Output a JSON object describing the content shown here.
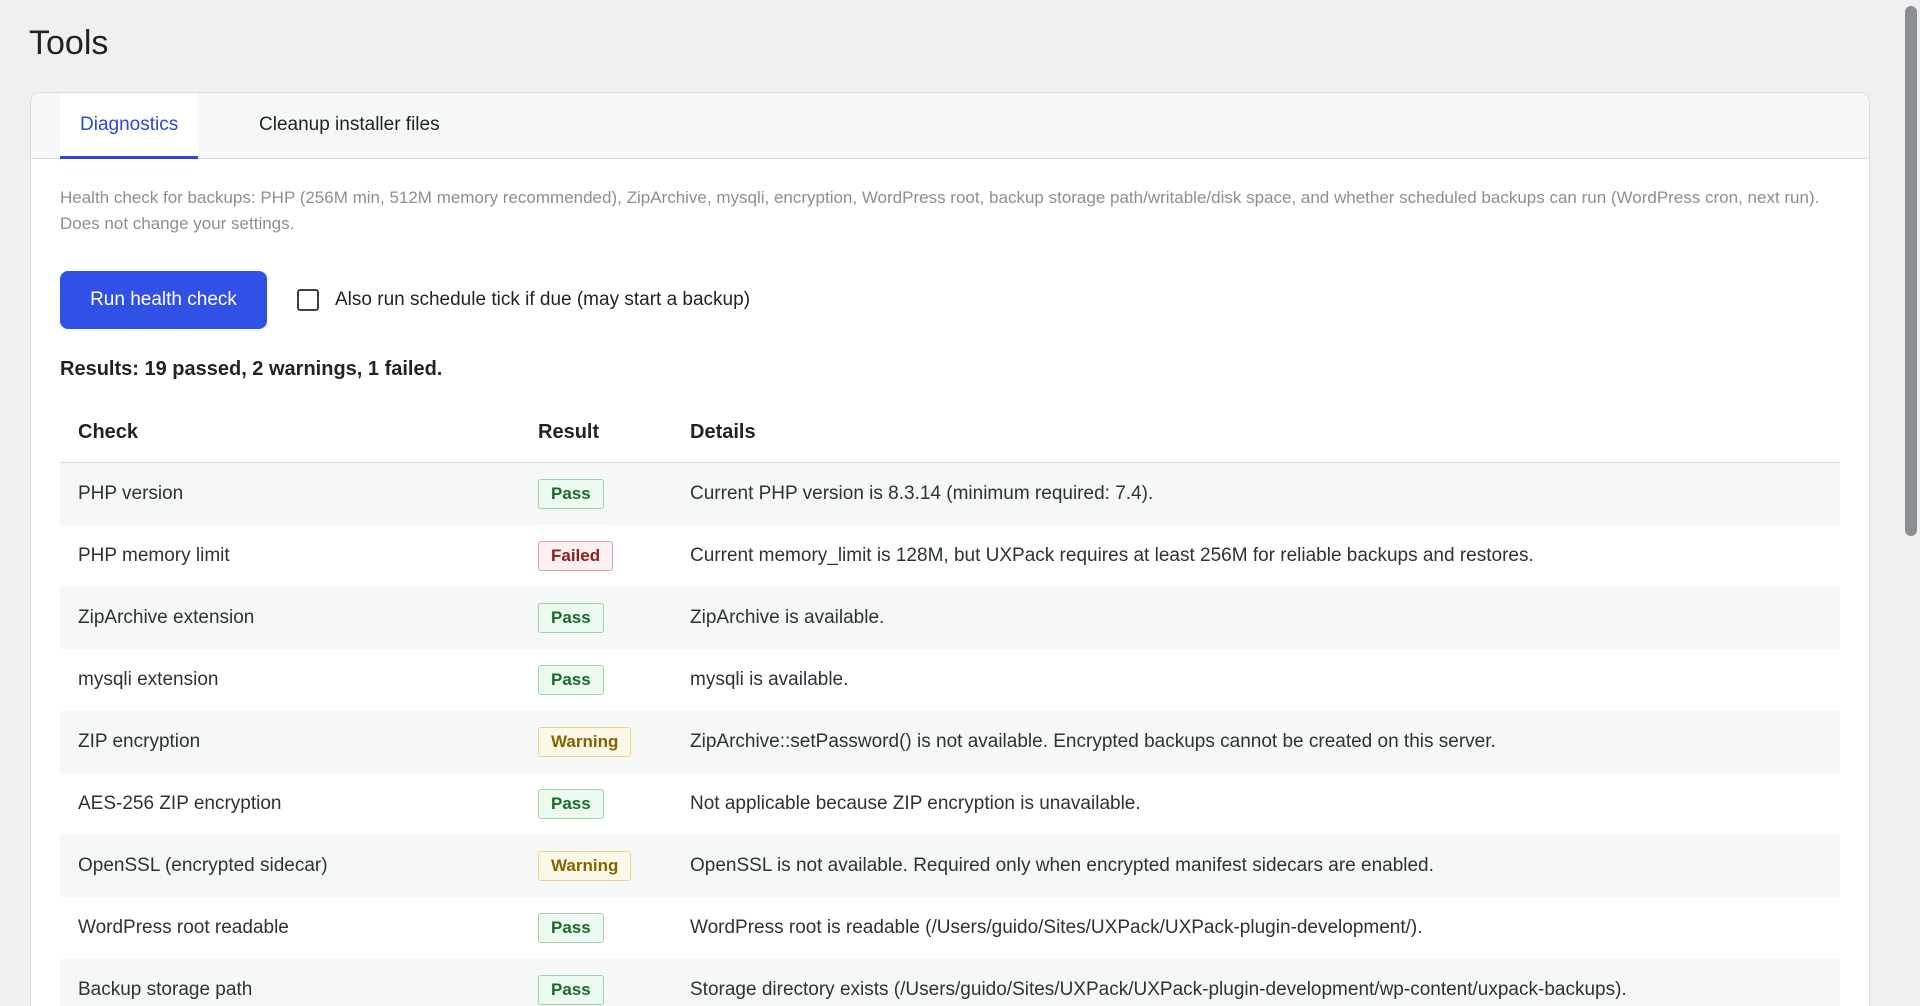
{
  "page": {
    "title": "Tools"
  },
  "tabs": [
    {
      "label": "Diagnostics",
      "active": true
    },
    {
      "label": "Cleanup installer files",
      "active": false
    }
  ],
  "diagnostics": {
    "intro": "Health check for backups: PHP (256M min, 512M memory recommended), ZipArchive, mysqli, encryption, WordPress root, backup storage path/writable/disk space, and whether scheduled backups can run (WordPress cron, next run). Does not change your settings.",
    "run_button_label": "Run health check",
    "schedule_checkbox_label": "Also run schedule tick if due (may start a backup)",
    "schedule_checkbox_checked": false,
    "results_summary": "Results: 19 passed, 2 warnings, 1 failed."
  },
  "table": {
    "headers": {
      "check": "Check",
      "result": "Result",
      "details": "Details"
    },
    "rows": [
      {
        "check": "PHP version",
        "result": "Pass",
        "status": "pass",
        "details": "Current PHP version is 8.3.14 (minimum required: 7.4)."
      },
      {
        "check": "PHP memory limit",
        "result": "Failed",
        "status": "failed",
        "details": "Current memory_limit is 128M, but UXPack requires at least 256M for reliable backups and restores."
      },
      {
        "check": "ZipArchive extension",
        "result": "Pass",
        "status": "pass",
        "details": "ZipArchive is available."
      },
      {
        "check": "mysqli extension",
        "result": "Pass",
        "status": "pass",
        "details": "mysqli is available."
      },
      {
        "check": "ZIP encryption",
        "result": "Warning",
        "status": "warning",
        "details": "ZipArchive::setPassword() is not available. Encrypted backups cannot be created on this server."
      },
      {
        "check": "AES-256 ZIP encryption",
        "result": "Pass",
        "status": "pass",
        "details": "Not applicable because ZIP encryption is unavailable."
      },
      {
        "check": "OpenSSL (encrypted sidecar)",
        "result": "Warning",
        "status": "warning",
        "details": "OpenSSL is not available. Required only when encrypted manifest sidecars are enabled."
      },
      {
        "check": "WordPress root readable",
        "result": "Pass",
        "status": "pass",
        "details": "WordPress root is readable (/Users/guido/Sites/UXPack/UXPack-plugin-development/)."
      },
      {
        "check": "Backup storage path",
        "result": "Pass",
        "status": "pass",
        "details": "Storage directory exists (/Users/guido/Sites/UXPack/UXPack-plugin-development/wp-content/uxpack-backups)."
      }
    ]
  },
  "colors": {
    "accent": "#2b47d6",
    "button": "#3151e6",
    "pass": "#1a6b2b",
    "failed": "#8a1f1f",
    "warning": "#8a6100"
  }
}
